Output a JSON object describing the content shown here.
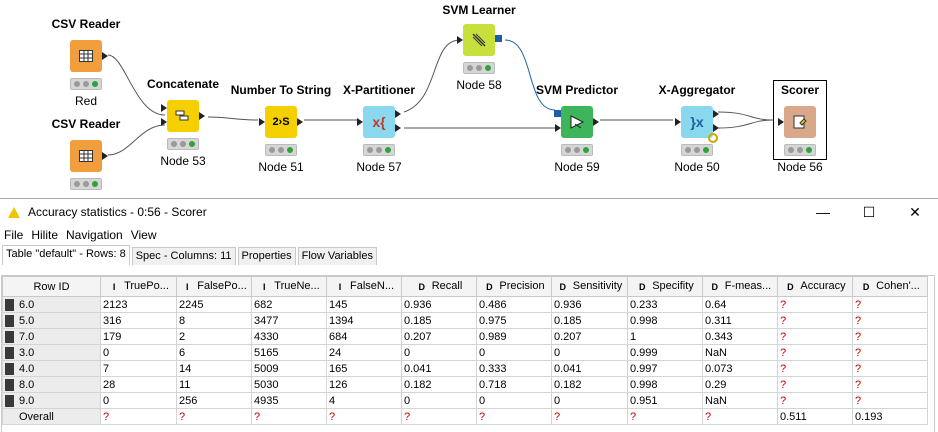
{
  "workflow": {
    "nodes": [
      {
        "id": "csv1",
        "name": "CSV Reader",
        "label": "Red",
        "icon": "table-icon",
        "color": "#f29e3d"
      },
      {
        "id": "csv2",
        "name": "CSV Reader",
        "label": "",
        "icon": "table-icon",
        "color": "#f29e3d"
      },
      {
        "id": "concat",
        "name": "Concatenate",
        "label": "Node 53",
        "icon": "concatenate-icon",
        "color": "#f5d000"
      },
      {
        "id": "num2str",
        "name": "Number To String",
        "label": "Node 51",
        "icon_text": "2›S",
        "color": "#f5d000"
      },
      {
        "id": "xpart",
        "name": "X-Partitioner",
        "label": "Node 57",
        "icon_text": "x{",
        "color": "#8ad8ee"
      },
      {
        "id": "svmlearn",
        "name": "SVM Learner",
        "label": "Node 58",
        "icon": "learner-icon",
        "color": "#c8e03c"
      },
      {
        "id": "svmpred",
        "name": "SVM Predictor",
        "label": "Node 59",
        "icon": "predictor-icon",
        "color": "#3fb55b"
      },
      {
        "id": "xagg",
        "name": "X-Aggregator",
        "label": "Node 50",
        "icon_text": "}x",
        "color": "#8ad8ee"
      },
      {
        "id": "scorer",
        "name": "Scorer",
        "label": "Node 56",
        "icon": "scorer-icon",
        "color": "#d9a88a"
      }
    ]
  },
  "window": {
    "title": "Accuracy statistics - 0:56 - Scorer",
    "minimize": "—",
    "maximize": "☐",
    "close": "✕"
  },
  "menu": [
    "File",
    "Hilite",
    "Navigation",
    "View"
  ],
  "tabs": [
    "Table \"default\" - Rows: 8",
    "Spec - Columns: 11",
    "Properties",
    "Flow Variables"
  ],
  "table": {
    "columns": [
      {
        "label": "Row ID",
        "type": ""
      },
      {
        "label": "TruePo...",
        "type": "I"
      },
      {
        "label": "FalsePo...",
        "type": "I"
      },
      {
        "label": "TrueNe...",
        "type": "I"
      },
      {
        "label": "FalseN...",
        "type": "I"
      },
      {
        "label": "Recall",
        "type": "D"
      },
      {
        "label": "Precision",
        "type": "D"
      },
      {
        "label": "Sensitivity",
        "type": "D"
      },
      {
        "label": "Specifity",
        "type": "D"
      },
      {
        "label": "F-meas...",
        "type": "D"
      },
      {
        "label": "Accuracy",
        "type": "D"
      },
      {
        "label": "Cohen'...",
        "type": "D"
      }
    ],
    "rows": [
      [
        "6.0",
        "2123",
        "2245",
        "682",
        "145",
        "0.936",
        "0.486",
        "0.936",
        "0.233",
        "0.64",
        "?",
        "?"
      ],
      [
        "5.0",
        "316",
        "8",
        "3477",
        "1394",
        "0.185",
        "0.975",
        "0.185",
        "0.998",
        "0.311",
        "?",
        "?"
      ],
      [
        "7.0",
        "179",
        "2",
        "4330",
        "684",
        "0.207",
        "0.989",
        "0.207",
        "1",
        "0.343",
        "?",
        "?"
      ],
      [
        "3.0",
        "0",
        "6",
        "5165",
        "24",
        "0",
        "0",
        "0",
        "0.999",
        "NaN",
        "?",
        "?"
      ],
      [
        "4.0",
        "7",
        "14",
        "5009",
        "165",
        "0.041",
        "0.333",
        "0.041",
        "0.997",
        "0.073",
        "?",
        "?"
      ],
      [
        "8.0",
        "28",
        "11",
        "5030",
        "126",
        "0.182",
        "0.718",
        "0.182",
        "0.998",
        "0.29",
        "?",
        "?"
      ],
      [
        "9.0",
        "0",
        "256",
        "4935",
        "4",
        "0",
        "0",
        "0",
        "0.951",
        "NaN",
        "?",
        "?"
      ],
      [
        "Overall",
        "?",
        "?",
        "?",
        "?",
        "?",
        "?",
        "?",
        "?",
        "?",
        "0.511",
        "0.193"
      ]
    ]
  }
}
